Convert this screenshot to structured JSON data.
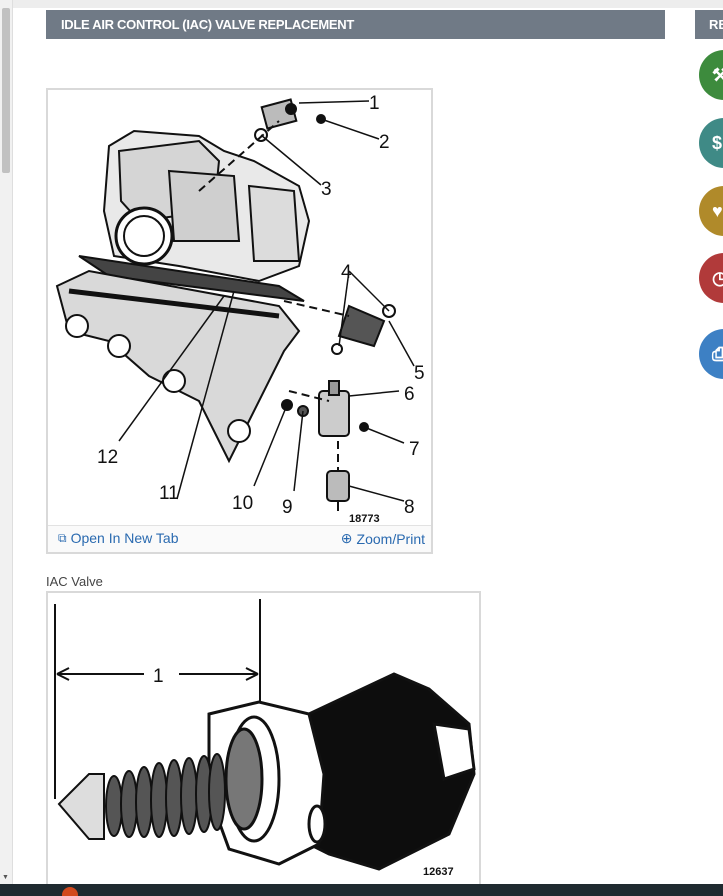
{
  "page": {
    "title": "IDLE AIR CONTROL (IAC) VALVE REPLACEMENT",
    "side_panel_title": "RE"
  },
  "side_rail": [
    {
      "icon": "wrench-icon",
      "color": "#3d8b3d"
    },
    {
      "icon": "dollar-icon",
      "color": "#3f8a86"
    },
    {
      "icon": "tag-icon",
      "color": "#b08a2a"
    },
    {
      "icon": "gauge-icon",
      "color": "#b13a3a"
    },
    {
      "icon": "printer-icon",
      "color": "#3d80c4"
    }
  ],
  "figure1": {
    "figure_number": "18773",
    "callouts": [
      "1",
      "2",
      "3",
      "4",
      "5",
      "6",
      "7",
      "8",
      "9",
      "10",
      "11",
      "12"
    ],
    "open_link": "Open In New Tab",
    "zoom_link": "Zoom/Print"
  },
  "figure2": {
    "caption": "IAC Valve",
    "figure_number": "12637",
    "callouts": [
      "1"
    ]
  }
}
